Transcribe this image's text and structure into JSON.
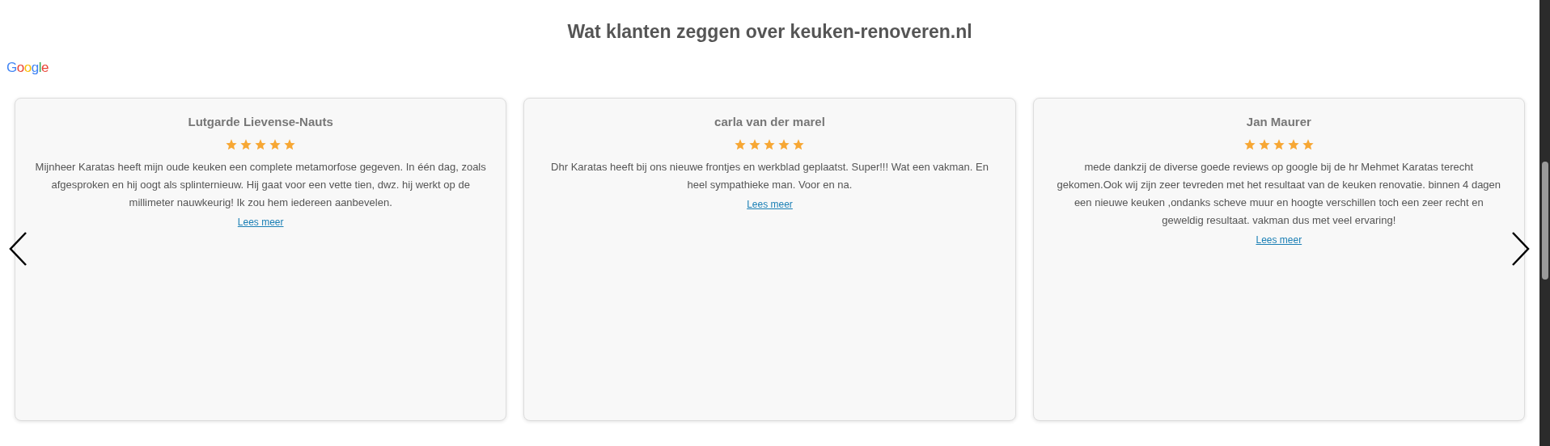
{
  "heading": "Wat klanten zeggen over keuken-renoveren.nl",
  "logo": {
    "text": "Google"
  },
  "reviews": [
    {
      "name": "Lutgarde Lievense-Nauts",
      "stars": 5,
      "text": "Mijnheer Karatas heeft mijn oude keuken een complete metamorfose gegeven. In één dag, zoals afgesproken en hij oogt als splinternieuw. Hij gaat voor een vette tien, dwz. hij werkt op de millimeter nauwkeurig! Ik zou hem iedereen aanbevelen.",
      "link": "Lees meer"
    },
    {
      "name": "carla van der marel",
      "stars": 5,
      "text": "Dhr Karatas heeft bij ons nieuwe frontjes en werkblad geplaatst. Super!!! Wat een vakman. En heel sympathieke man. Voor en na.",
      "link": "Lees meer"
    },
    {
      "name": "Jan Maurer",
      "stars": 5,
      "text": "mede dankzij de diverse goede reviews op google bij de hr Mehmet Karatas terecht gekomen.Ook wij zijn zeer tevreden met het resultaat van de keuken renovatie. binnen 4 dagen een nieuwe keuken ,ondanks scheve muur en hoogte verschillen toch een zeer recht en geweldig resultaat. vakman dus met veel ervaring!",
      "link": "Lees meer"
    }
  ]
}
